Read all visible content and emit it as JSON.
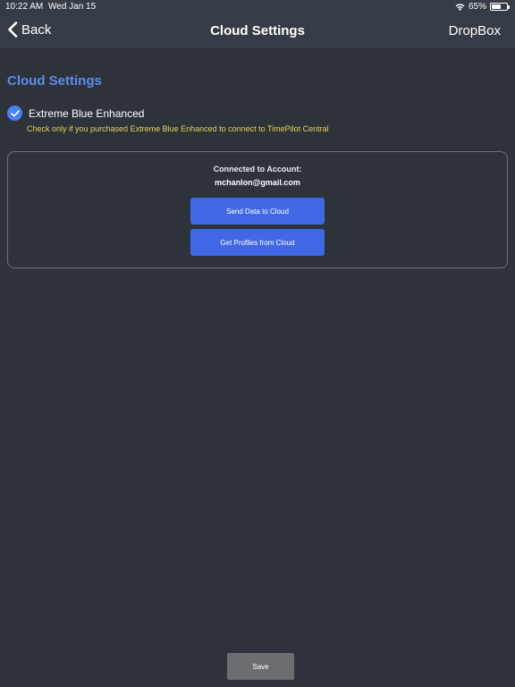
{
  "status_bar": {
    "time": "10:22 AM",
    "date": "Wed Jan 15",
    "battery_percent": "65%",
    "battery_level": 0.65,
    "wifi_icon": "wifi-icon",
    "battery_icon": "battery-icon"
  },
  "nav": {
    "back_label": "Back",
    "back_icon": "chevron-left-icon",
    "title": "Cloud Settings",
    "right_label": "DropBox"
  },
  "section": {
    "title": "Cloud Settings"
  },
  "option": {
    "checked": true,
    "label": "Extreme Blue Enhanced",
    "hint": "Check only if you purchased Extreme Blue Enhanced to connect to TimePilot Central"
  },
  "account": {
    "label": "Connected to Account:",
    "email": "mchanlon@gmail.com",
    "send_button": "Send Data to Cloud",
    "get_button": "Get Profiles from Cloud"
  },
  "footer": {
    "save_label": "Save"
  },
  "colors": {
    "background": "#2e333b",
    "header": "#353c47",
    "accent_blue": "#5b8def",
    "button_blue": "#4168e4",
    "hint_yellow": "#e8d25a",
    "save_gray": "#6b6d70"
  }
}
